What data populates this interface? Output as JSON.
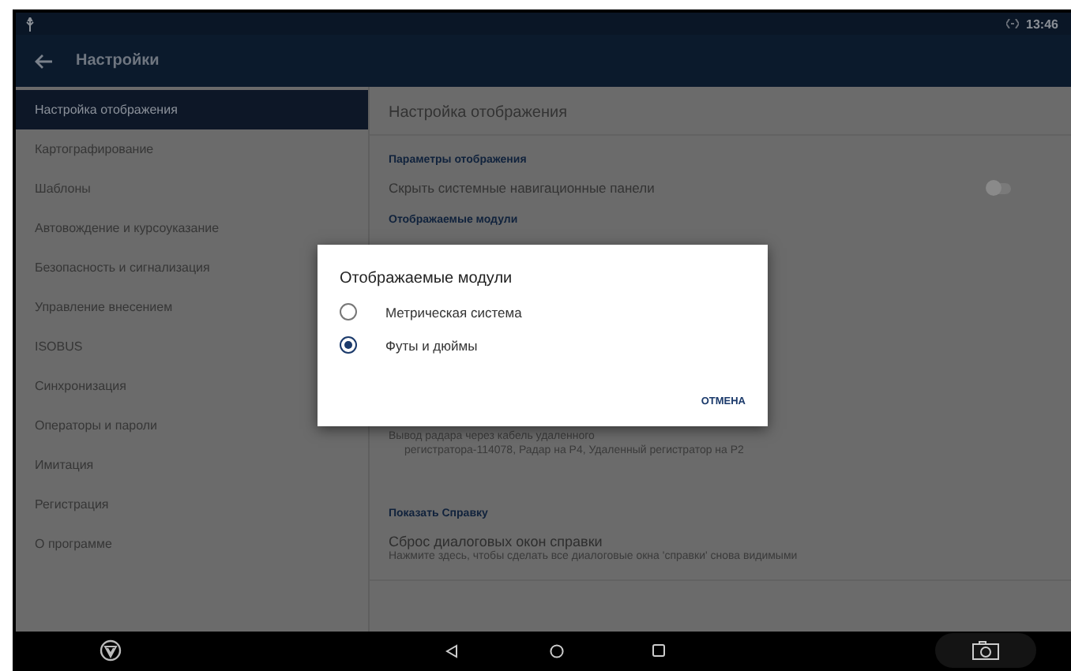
{
  "status_bar": {
    "time": "13:46"
  },
  "app_bar": {
    "title": "Настройки"
  },
  "sidebar": {
    "items": [
      {
        "label": "Настройка отображения",
        "selected": true
      },
      {
        "label": "Картографирование",
        "selected": false
      },
      {
        "label": "Шаблоны",
        "selected": false
      },
      {
        "label": "Автовождение и курсоуказание",
        "selected": false
      },
      {
        "label": "Безопасность и сигнализация",
        "selected": false
      },
      {
        "label": "Управление внесением",
        "selected": false
      },
      {
        "label": "ISOBUS",
        "selected": false
      },
      {
        "label": "Синхронизация",
        "selected": false
      },
      {
        "label": "Операторы и пароли",
        "selected": false
      },
      {
        "label": "Имитация",
        "selected": false
      },
      {
        "label": "Регистрация",
        "selected": false
      },
      {
        "label": "О программе",
        "selected": false
      }
    ]
  },
  "content": {
    "title": "Настройка отображения",
    "sections": [
      {
        "header": "Параметры отображения",
        "rows": [
          {
            "kind": "toggle",
            "label": "Скрыть системные навигационные панели",
            "on": false
          }
        ]
      },
      {
        "header": "Отображаемые модули",
        "rows": [
          {
            "kind": "lines",
            "lines": [
              "Вывод радара через кабель удаленного",
              "регистратора-114078, Радар на P4, Удаленный регистратор на P2"
            ]
          }
        ]
      },
      {
        "header": "Показать Справку",
        "rows": [
          {
            "kind": "item",
            "label": "Сброс диалоговых окон справки",
            "description": "Нажмите здесь, чтобы сделать все диалоговые окна 'справки' снова видимыми"
          }
        ]
      }
    ]
  },
  "dialog": {
    "title": "Отображаемые модули",
    "options": [
      {
        "label": "Метрическая система",
        "selected": false
      },
      {
        "label": "Футы и дюймы",
        "selected": true
      }
    ],
    "cancel": "ОТМЕНА"
  }
}
